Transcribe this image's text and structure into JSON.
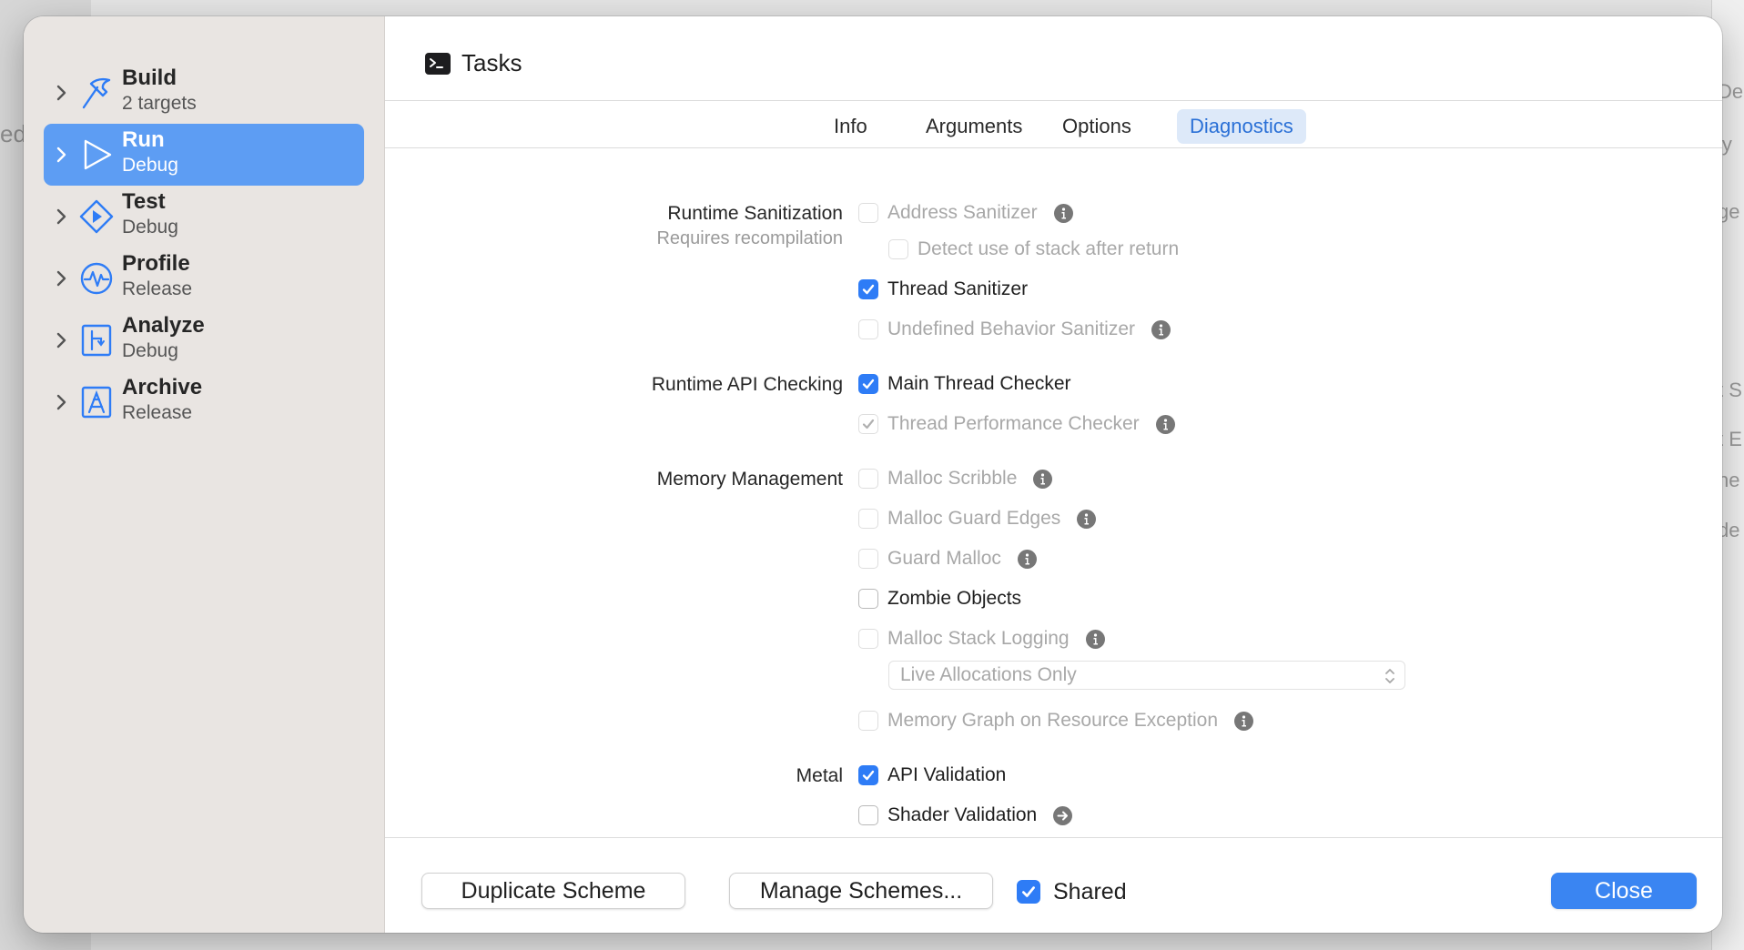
{
  "background": {
    "left_fragment": "ed",
    "right_fragments": [
      "De",
      "ly",
      "ge",
      "t S",
      "t E",
      "ne",
      "de"
    ]
  },
  "sidebar": {
    "actions": [
      {
        "title": "Build",
        "subtitle": "2 targets",
        "icon": "hammer-icon",
        "selected": false
      },
      {
        "title": "Run",
        "subtitle": "Debug",
        "icon": "play-icon",
        "selected": true
      },
      {
        "title": "Test",
        "subtitle": "Debug",
        "icon": "test-diamond-icon",
        "selected": false
      },
      {
        "title": "Profile",
        "subtitle": "Release",
        "icon": "waveform-icon",
        "selected": false
      },
      {
        "title": "Analyze",
        "subtitle": "Debug",
        "icon": "analyze-icon",
        "selected": false
      },
      {
        "title": "Archive",
        "subtitle": "Release",
        "icon": "archive-icon",
        "selected": false
      }
    ]
  },
  "header": {
    "scheme_name": "Tasks",
    "icon": "terminal-icon"
  },
  "tabs": [
    {
      "label": "Info",
      "active": false
    },
    {
      "label": "Arguments",
      "active": false
    },
    {
      "label": "Options",
      "active": false
    },
    {
      "label": "Diagnostics",
      "active": true
    }
  ],
  "sections": {
    "runtime_sanitization": {
      "label": "Runtime Sanitization",
      "sublabel": "Requires recompilation",
      "address_sanitizer": "Address Sanitizer",
      "detect_stack": "Detect use of stack after return",
      "thread_sanitizer": "Thread Sanitizer",
      "ub_sanitizer": "Undefined Behavior Sanitizer"
    },
    "runtime_api": {
      "label": "Runtime API Checking",
      "main_thread_checker": "Main Thread Checker",
      "thread_performance_checker": "Thread Performance Checker"
    },
    "memory": {
      "label": "Memory Management",
      "malloc_scribble": "Malloc Scribble",
      "malloc_guard_edges": "Malloc Guard Edges",
      "guard_malloc": "Guard Malloc",
      "zombie_objects": "Zombie Objects",
      "malloc_stack_logging": "Malloc Stack Logging",
      "stack_logging_mode": "Live Allocations Only",
      "memory_graph": "Memory Graph on Resource Exception"
    },
    "metal": {
      "label": "Metal",
      "api_validation": "API Validation",
      "shader_validation": "Shader Validation"
    }
  },
  "checkbox_states": {
    "address_sanitizer": false,
    "detect_stack": false,
    "thread_sanitizer": true,
    "ub_sanitizer": false,
    "main_thread_checker": true,
    "thread_performance_checker": true,
    "malloc_scribble": false,
    "malloc_guard_edges": false,
    "guard_malloc": false,
    "zombie_objects": false,
    "malloc_stack_logging": false,
    "memory_graph": false,
    "api_validation": true,
    "shader_validation": false,
    "shared": true
  },
  "footer": {
    "duplicate": "Duplicate Scheme",
    "manage": "Manage Schemes...",
    "shared": "Shared",
    "close": "Close"
  },
  "colors": {
    "accent": "#2e7cf6",
    "sidebar_selected": "#5d9df3",
    "tab_active_bg": "#dde9f9",
    "tab_active_text": "#2a70d6",
    "close_button": "#3a85f2"
  }
}
